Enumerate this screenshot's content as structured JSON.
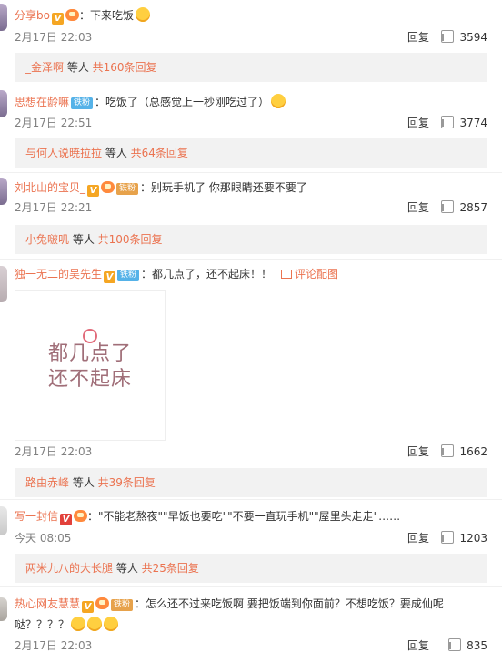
{
  "comments": [
    {
      "user": "分享bo",
      "text": "：下来吃饭",
      "time": "2月17日 22:03",
      "reply": "回复",
      "likes": "3594",
      "sub_user": "_金泽啊",
      "sub_mid": " 等人 ",
      "sub_count": "共160条回复"
    },
    {
      "user": "思想在龄嘛",
      "badge": "铁粉",
      "text": "：吃饭了（总感觉上一秒刚吃过了）",
      "time": "2月17日 22:51",
      "reply": "回复",
      "likes": "3774",
      "sub_user": "与何人说暁拉拉",
      "sub_mid": " 等人 ",
      "sub_count": "共64条回复"
    },
    {
      "user": "刘北山的宝贝_",
      "badge": "铁粉",
      "text": "：别玩手机了 你那眼睛还要不要了",
      "time": "2月17日 22:21",
      "reply": "回复",
      "likes": "2857",
      "sub_user": "小兔啵叽",
      "sub_mid": " 等人 ",
      "sub_count": "共100条回复"
    },
    {
      "user": "独一无二的吴先生",
      "badge": "铁粉",
      "text": "：都几点了，还不起床！！",
      "pic_link": "评论配图",
      "pic_text_1": "都几点了",
      "pic_text_2": "还不起床",
      "time": "2月17日 22:03",
      "reply": "回复",
      "likes": "1662",
      "sub_user": "路由赤峰",
      "sub_mid": " 等人 ",
      "sub_count": "共39条回复"
    },
    {
      "user": "写一封信",
      "text": "：\"不能老熬夜\"\"早饭也要吃\"\"不要一直玩手机\"\"屋里头走走\"……",
      "time": "今天 08:05",
      "reply": "回复",
      "likes": "1203",
      "sub_user": "两米九八的大长腿",
      "sub_mid": " 等人 ",
      "sub_count": "共25条回复"
    },
    {
      "user": "热心网友慧慧",
      "badge": "铁粉",
      "text": "：怎么还不过来吃饭啊 要把饭端到你面前？不想吃饭？要成仙呢",
      "text2": "哒？？？？",
      "time": "2月17日 22:03",
      "reply": "回复",
      "likes": "835"
    }
  ],
  "colors": {
    "accent": "#eb7350",
    "muted": "#808080",
    "subbg": "#f2f2f2",
    "fan": "#55b2e8"
  }
}
